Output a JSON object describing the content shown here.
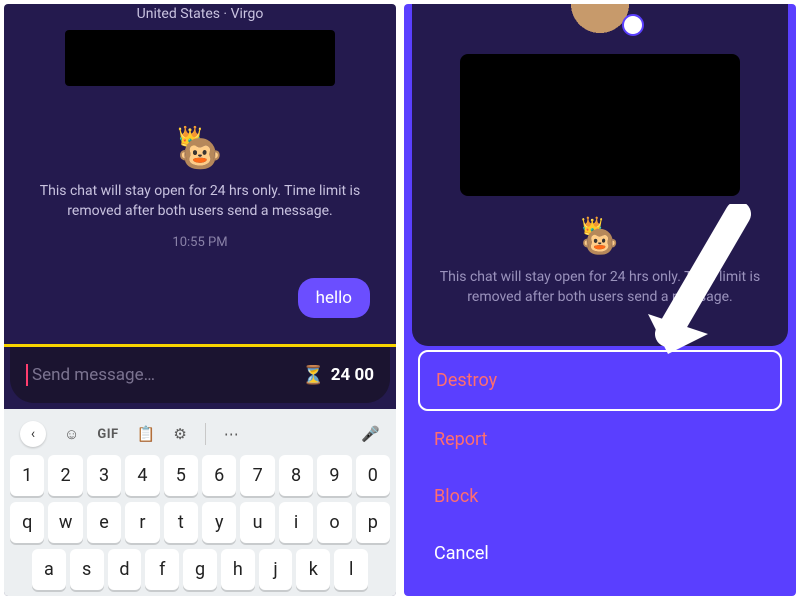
{
  "left": {
    "header": "United States · Virgo",
    "notice": "This chat will stay open for 24 hrs only. Time limit is removed after both users send a message.",
    "timestamp": "10:55 PM",
    "bubble": "hello",
    "input_placeholder": "Send message…",
    "timer": "24 00",
    "monkey_icon": "🐵",
    "crown_icon": "👑",
    "hourglass_icon": "⏳"
  },
  "keyboard": {
    "toolbar": {
      "collapse": "‹",
      "sticker": "☺",
      "gif": "GIF",
      "clipboard": "📋",
      "settings": "⚙",
      "more": "⋯",
      "mic": "🎤"
    },
    "row1": [
      "1",
      "2",
      "3",
      "4",
      "5",
      "6",
      "7",
      "8",
      "9",
      "0"
    ],
    "row2": [
      "q",
      "w",
      "e",
      "r",
      "t",
      "y",
      "u",
      "i",
      "o",
      "p"
    ],
    "row3": [
      "a",
      "s",
      "d",
      "f",
      "g",
      "h",
      "j",
      "k",
      "l"
    ]
  },
  "right": {
    "notice": "This chat will stay open for 24 hrs only. Time limit is removed after both users send a message.",
    "monkey_icon": "🐵",
    "crown_icon": "👑",
    "sheet": {
      "destroy": "Destroy",
      "report": "Report",
      "block": "Block",
      "cancel": "Cancel"
    }
  }
}
